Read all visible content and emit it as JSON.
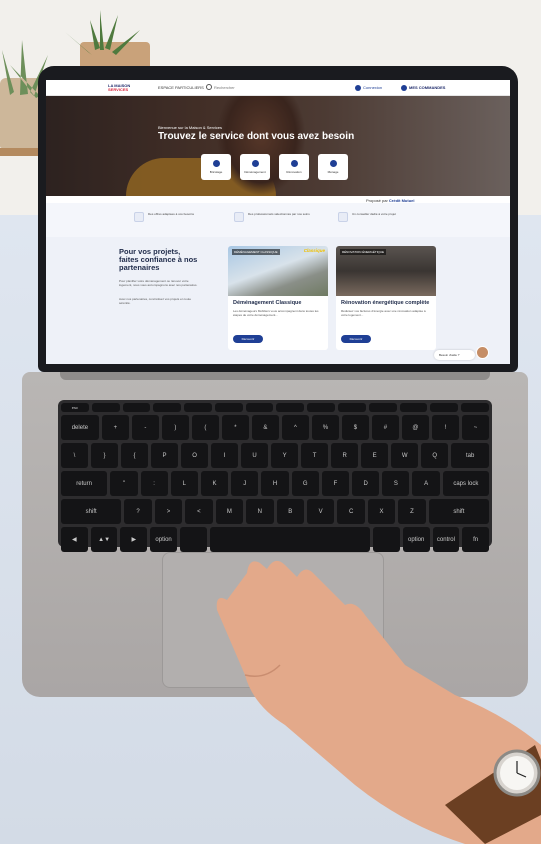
{
  "site": {
    "logo_line1": "LA MAISON",
    "logo_line2": "SERVICES",
    "nav_particuliers": "ESPACE PARTICULIERS",
    "nav_search": "Rechercher",
    "nav_connexion": "Connexion",
    "nav_commandes": "MES COMMANDES"
  },
  "hero": {
    "kicker": "Bienvenue sur la Maison & Services",
    "title": "Trouvez le service dont vous avez besoin",
    "cards": [
      "Bricolage",
      "Déménagement",
      "Rénovation",
      "Ménage"
    ]
  },
  "partner": {
    "prefix": "Proposé par",
    "brand": "Crédit Mutuel"
  },
  "features": [
    "Des offres adaptées à vos besoins",
    "Des professionnels sélectionnés par nos soins",
    "Un conseiller dédié à votre projet"
  ],
  "content": {
    "side_title": "Pour vos projets, faites confiance à nos partenaires",
    "side_text": "Pour planifier votre déménagement ou rénover votre logement, nous vous accompagnons avec nos partenaires.",
    "side_text2": "Avec nos partenaires, concrétisez vos projets en toute sérénité.",
    "cards": [
      {
        "tag": "DÉMÉNAGEMENT CLASSIQUE",
        "badge": "Classique",
        "title": "Déménagement Classique",
        "text": "Les déménageurs Mobiliers vous accompagnent dans toutes les étapes de votre déménagement...",
        "button": "Découvrir"
      },
      {
        "tag": "RÉNOVATION ÉNERGÉTIQUE",
        "badge": "",
        "title": "Rénovation énergétique complète",
        "text": "Réduisez vos factures d'énergie avec une rénovation adaptée à votre logement...",
        "button": "Découvrir"
      }
    ],
    "chat": "Besoin d'aide ?"
  },
  "keyboard": {
    "row1": [
      "esc",
      "",
      "",
      "",
      "",
      "",
      "",
      "",
      "",
      "",
      "",
      "",
      "",
      ""
    ],
    "row2": [
      "delete",
      "+",
      "-",
      ")",
      "(",
      "*",
      "&",
      "^",
      "%",
      "$",
      "#",
      "@",
      "!",
      "~"
    ],
    "row3": [
      "\\",
      "}",
      "{",
      "P",
      "O",
      "I",
      "U",
      "Y",
      "T",
      "R",
      "E",
      "W",
      "Q",
      "tab"
    ],
    "row4": [
      "return",
      "\"",
      ":",
      "L",
      "K",
      "J",
      "H",
      "G",
      "F",
      "D",
      "S",
      "A",
      "caps lock"
    ],
    "row5": [
      "shift",
      "?",
      ">",
      "<",
      "M",
      "N",
      "B",
      "V",
      "C",
      "X",
      "Z",
      "shift"
    ],
    "row6": [
      "◀",
      "▲▼",
      "▶",
      "option",
      "",
      "",
      "option",
      "control",
      "fn"
    ]
  },
  "colors": {
    "brand_blue": "#1f3f95",
    "accent_yellow": "#f0c000",
    "laptop_silver": "#b2afae"
  }
}
